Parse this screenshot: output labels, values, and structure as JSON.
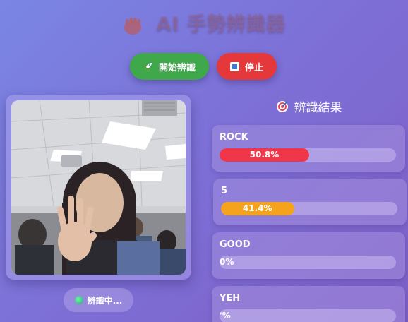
{
  "app": {
    "title": "AI 手勢辨識器",
    "title_icon": "fist-icon"
  },
  "toolbar": {
    "start_label": "開始辨識",
    "start_icon": "rocket-icon",
    "stop_label": "停止",
    "stop_icon": "stop-square-icon",
    "start_color": "#3ea84a",
    "stop_color": "#e5383b"
  },
  "camera": {
    "status_label": "辨識中...",
    "status_color": "#1ca870"
  },
  "results": {
    "title": "辨識結果",
    "title_icon": "target-icon",
    "items": [
      {
        "label": "ROCK",
        "percent_text": "50.8%",
        "value": 50.8,
        "color": "#f0374a"
      },
      {
        "label": "5",
        "percent_text": "41.4%",
        "value": 41.4,
        "color": "#f5a31c"
      },
      {
        "label": "GOOD",
        "percent_text": "0%",
        "value": 0,
        "color": "#f5a31c"
      },
      {
        "label": "YEH",
        "percent_text": "'%",
        "value": 0,
        "color": "#f5a31c"
      }
    ]
  }
}
